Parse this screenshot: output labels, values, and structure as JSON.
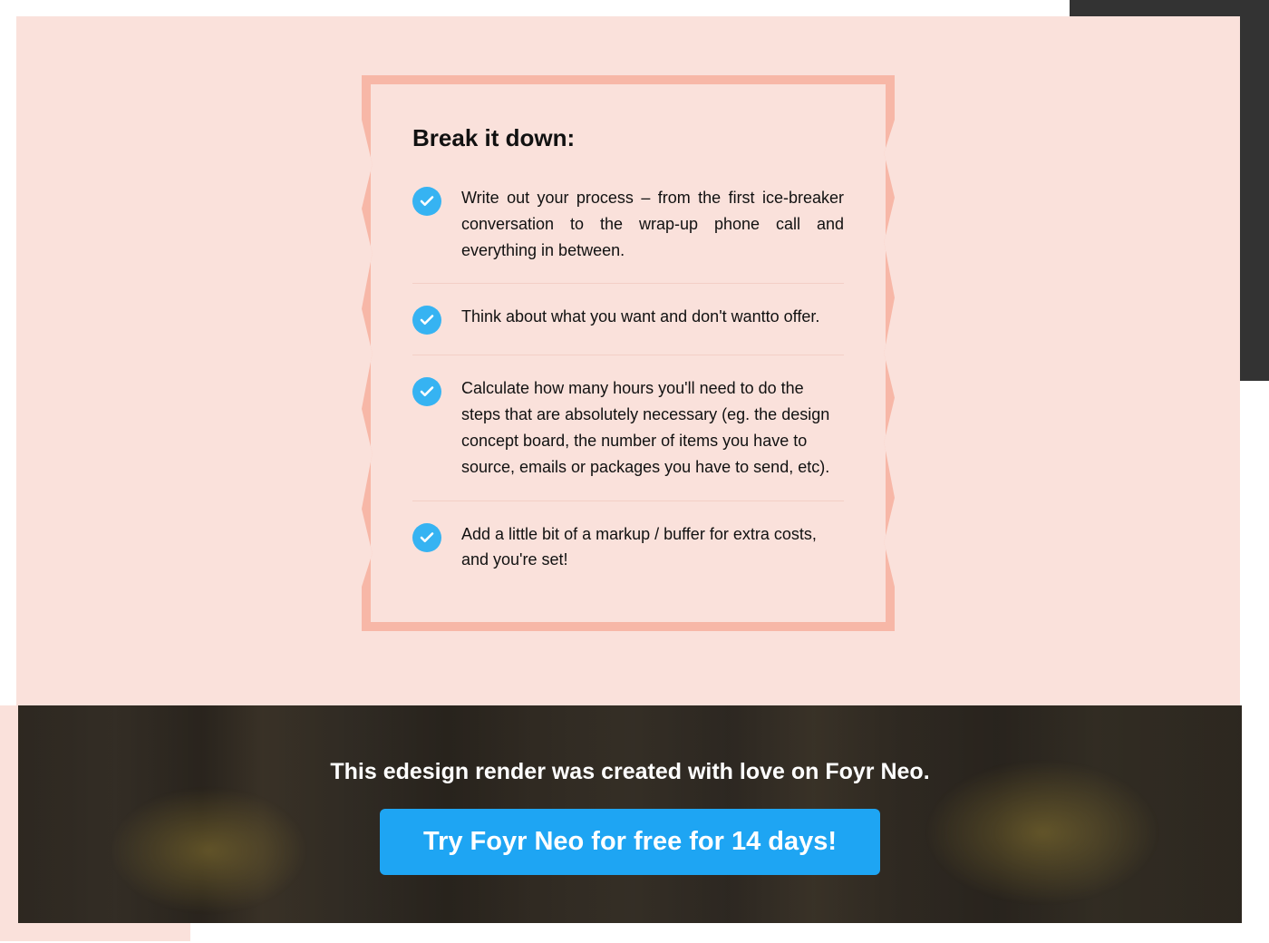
{
  "callout": {
    "title": "Break it down:",
    "items": [
      "Write out your process – from the first ice-breaker conversation to the wrap-up phone call and everything in between.",
      "Think about what you want and don't wantto offer.",
      "Calculate how many hours you'll need to do the steps that are absolutely necessary (eg. the design concept board, the number of items you have to source, emails or packages you have to send, etc).",
      "Add a little bit of a markup / buffer for extra costs, and you're set!"
    ]
  },
  "hero": {
    "caption": "This edesign render was created with love on Foyr Neo.",
    "cta_label": "Try Foyr Neo for free for 14 days!"
  },
  "colors": {
    "pink_bg": "#fae1db",
    "pink_border": "#f7b7a7",
    "accent_blue": "#1ea5f3",
    "check_blue": "#36b3f2",
    "dark_strip": "#333333"
  }
}
